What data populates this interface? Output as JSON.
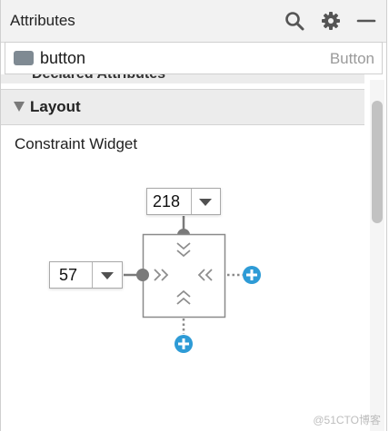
{
  "panel": {
    "title": "Attributes",
    "icons": [
      "search-icon",
      "gear-icon",
      "minimize-icon"
    ]
  },
  "component": {
    "name": "button",
    "type": "Button"
  },
  "sections": {
    "declared_label": "Declared Attributes",
    "layout_label": "Layout"
  },
  "constraint": {
    "label": "Constraint Widget",
    "top_margin": "218",
    "left_margin": "57"
  },
  "watermark": "@51CTO博客",
  "colors": {
    "accent": "#2e9bd6",
    "handle": "#7a7a7a",
    "header_bg": "#ececec"
  }
}
